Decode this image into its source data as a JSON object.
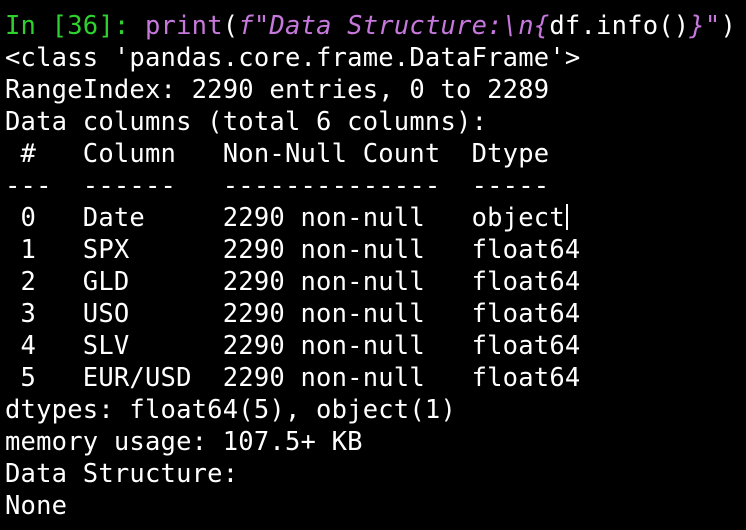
{
  "input": {
    "prompt": "In [36]: ",
    "func": "print",
    "open_paren": "(",
    "fstr_prefix": "f\"Data Structure:\\n",
    "fstr_open_brace": "{",
    "fstr_expr": "df.info()",
    "fstr_close_brace": "}",
    "fstr_end_quote": "\"",
    "close_paren": ")"
  },
  "output": {
    "class_line": "<class 'pandas.core.frame.DataFrame'>",
    "range_index": "RangeIndex: 2290 entries, 0 to 2289",
    "data_columns": "Data columns (total 6 columns):",
    "header": " #   Column   Non-Null Count  Dtype  ",
    "separator": "---  ------   --------------  -----  ",
    "rows": [
      " 0   Date     2290 non-null   object",
      " 1   SPX      2290 non-null   float64",
      " 2   GLD      2290 non-null   float64",
      " 3   USO      2290 non-null   float64",
      " 4   SLV      2290 non-null   float64",
      " 5   EUR/USD  2290 non-null   float64"
    ],
    "dtypes": "dtypes: float64(5), object(1)",
    "memory": "memory usage: 107.5+ KB",
    "data_structure": "Data Structure:",
    "none": "None"
  },
  "colors": {
    "prompt": "#2ed12e",
    "keyword": "#c678dd",
    "text": "#ffffff",
    "background": "#000000"
  }
}
